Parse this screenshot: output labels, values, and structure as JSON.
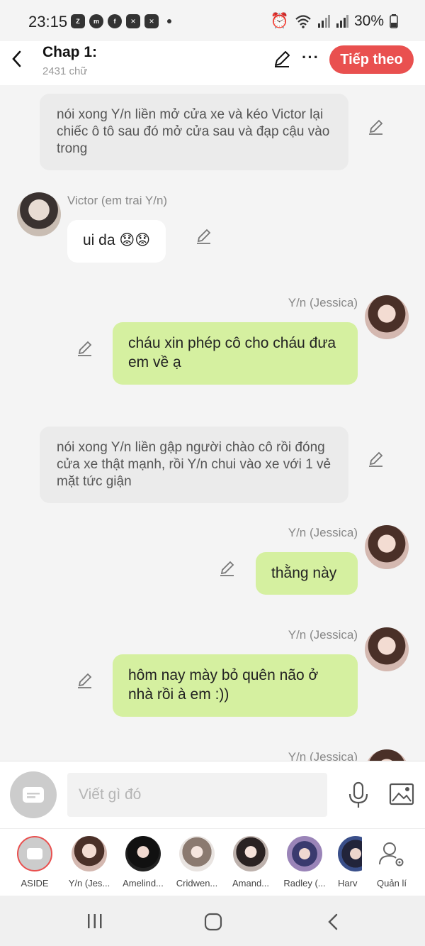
{
  "status": {
    "time": "23:15",
    "battery": "30%",
    "icons": [
      "zalo-icon",
      "messenger-icon",
      "facebook-icon",
      "capcut-icon",
      "capcut-icon",
      "dot"
    ]
  },
  "header": {
    "title": "Chap 1:",
    "word_count": "2431 chữ",
    "next_label": "Tiếp theo"
  },
  "messages": [
    {
      "kind": "narration",
      "text": "nói xong Y/n liền mở cửa xe và kéo Victor lại chiếc ô tô sau đó mở cửa sau và đạp cậu vào trong"
    },
    {
      "kind": "left",
      "speaker": "Victor (em trai Y/n)",
      "text": "ui da 😟😟"
    },
    {
      "kind": "right",
      "speaker": "Y/n (Jessica)",
      "text": "cháu xin phép cô cho cháu đưa em về ạ"
    },
    {
      "kind": "narration",
      "text": "nói xong Y/n liền gập người chào cô rồi đóng cửa xe thật mạnh, rồi Y/n chui vào xe với 1 vẻ mặt tức giận"
    },
    {
      "kind": "right",
      "speaker": "Y/n (Jessica)",
      "text": "thằng này"
    },
    {
      "kind": "right",
      "speaker": "Y/n (Jessica)",
      "text": "hôm nay mày bỏ quên não ở nhà rồi à em :))"
    },
    {
      "kind": "right",
      "speaker": "Y/n (Jessica)",
      "text": ""
    }
  ],
  "input": {
    "placeholder": "Viết gì đó"
  },
  "characters": [
    {
      "label": "ASIDE"
    },
    {
      "label": "Y/n (Jes..."
    },
    {
      "label": "Amelind..."
    },
    {
      "label": "Cridwen..."
    },
    {
      "label": "Amand..."
    },
    {
      "label": "Radley (..."
    },
    {
      "label": "Harv"
    },
    {
      "label": "Quản lí"
    }
  ],
  "colors": {
    "accent": "#e9504f",
    "right_bubble": "#d5f0a0",
    "narration_bg": "#ebebeb"
  }
}
